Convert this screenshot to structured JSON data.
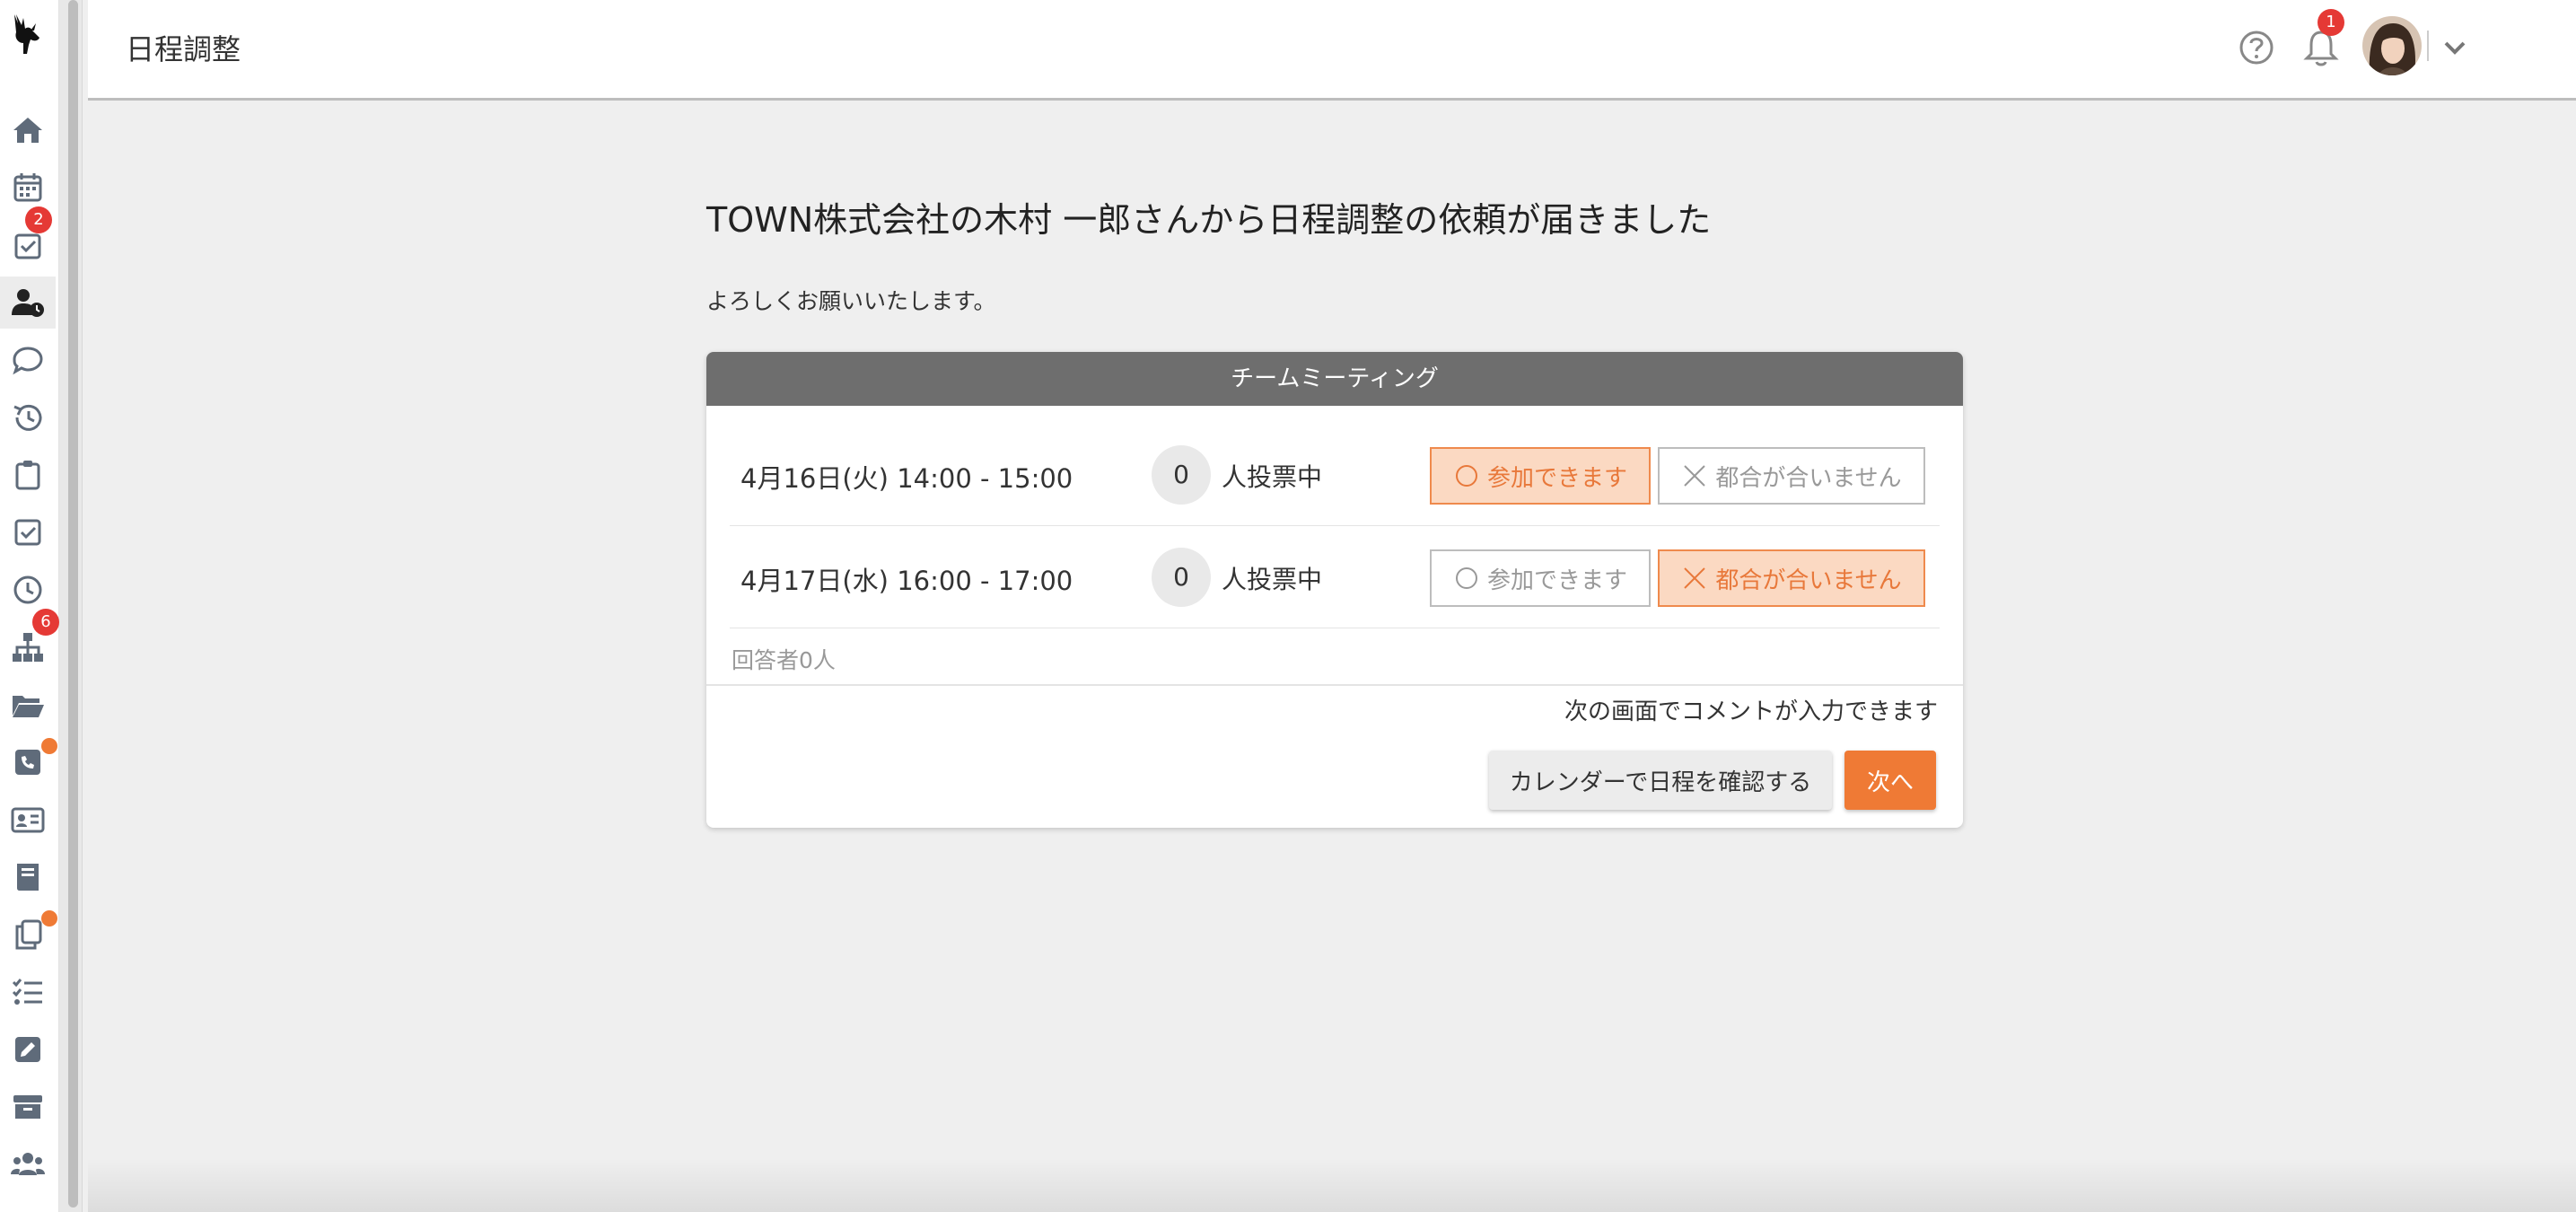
{
  "header": {
    "title": "日程調整",
    "notification_count": "1"
  },
  "sidebar": {
    "items": [
      {
        "icon": "home-icon"
      },
      {
        "icon": "calendar-icon"
      },
      {
        "icon": "task-check-icon",
        "badge": "2"
      },
      {
        "icon": "user-clock-icon",
        "active": true
      },
      {
        "icon": "chat-bubble-icon"
      },
      {
        "icon": "history-icon"
      },
      {
        "icon": "clipboard-icon"
      },
      {
        "icon": "checkbox-icon"
      },
      {
        "icon": "clock-icon"
      },
      {
        "icon": "org-chart-icon",
        "badge": "6"
      },
      {
        "icon": "folder-open-icon"
      },
      {
        "icon": "phone-note-icon",
        "dot": true
      },
      {
        "icon": "contact-card-icon"
      },
      {
        "icon": "book-icon"
      },
      {
        "icon": "copy-icon",
        "dot": true
      },
      {
        "icon": "list-check-icon"
      },
      {
        "icon": "edit-icon"
      },
      {
        "icon": "archive-icon"
      },
      {
        "icon": "users-icon"
      }
    ]
  },
  "main": {
    "title": "TOWN株式会社の木村 一郎さんから日程調整の依頼が届きました",
    "message": "よろしくお願いいたします。"
  },
  "card": {
    "meeting_name": "チームミーティング",
    "options": [
      {
        "datetime": "4月16日(火) 14:00 - 15:00",
        "votes": "0",
        "votes_label": "人投票中",
        "yes_label": "参加できます",
        "no_label": "都合が合いません",
        "selected": "yes"
      },
      {
        "datetime": "4月17日(水) 16:00 - 17:00",
        "votes": "0",
        "votes_label": "人投票中",
        "yes_label": "参加できます",
        "no_label": "都合が合いません",
        "selected": "no"
      }
    ],
    "respondents": "回答者0人",
    "comment_note": "次の画面でコメントが入力できます",
    "calendar_button": "カレンダーで日程を確認する",
    "next_button": "次へ"
  },
  "colors": {
    "accent": "#ef7a35",
    "selected_bg": "#fbd9c2",
    "card_header": "#6e6e6e",
    "badge": "#e53935"
  }
}
